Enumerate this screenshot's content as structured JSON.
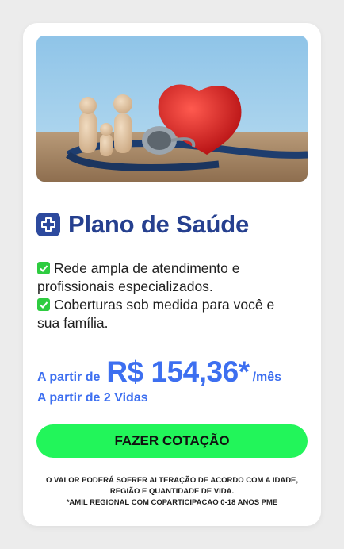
{
  "card": {
    "image_alt": "wooden family figures, red heart and stethoscope",
    "title": "Plano de Saúde",
    "title_icon": "plus-icon",
    "benefits": [
      {
        "icon": "check-icon",
        "text": "Rede ampla de atendimento e profissionais especializados."
      },
      {
        "icon": "check-icon",
        "text": "Coberturas sob medida para você e sua família."
      }
    ],
    "price": {
      "prefix": "A partir de",
      "value": "R$ 154,36*",
      "suffix": "/mês",
      "lives": "A partir de 2 Vidas"
    },
    "cta_label": "FAZER COTAÇÃO",
    "disclaimer": [
      "O VALOR PODERÁ SOFRER ALTERAÇÃO DE ACORDO COM A IDADE,",
      "REGIÃO E QUANTIDADE DE VIDA.",
      "*AMIL REGIONAL COM COPARTICIPACAO 0-18 ANOS PME"
    ]
  },
  "colors": {
    "title": "#26408f",
    "price": "#3d6ff0",
    "cta": "#22f55a",
    "check": "#2ecc40"
  }
}
